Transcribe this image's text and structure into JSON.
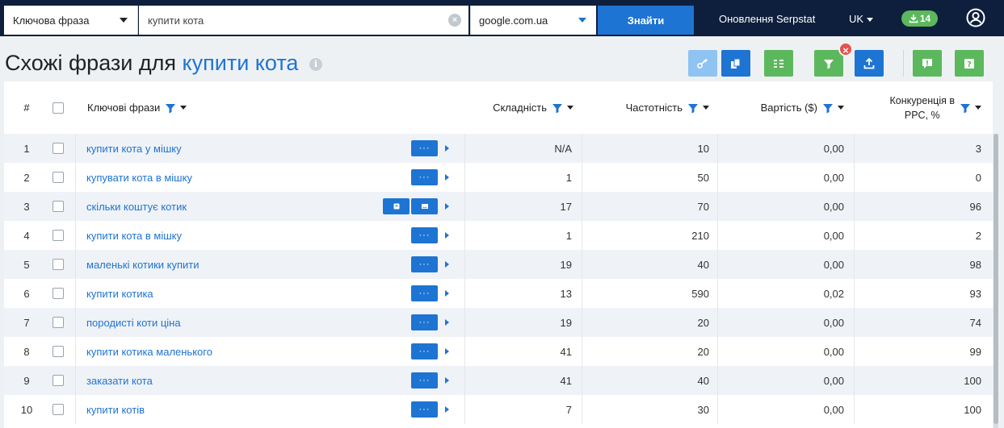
{
  "topbar": {
    "search_type": "Ключова фраза",
    "query": "купити кота",
    "database": "google.com.ua",
    "find_label": "Знайти",
    "updates_label": "Оновлення Serpstat",
    "language": "UK",
    "downloads_count": "14"
  },
  "title": {
    "prefix": "Схожі фрази для",
    "keyword": "купити кота"
  },
  "toolbar": {
    "buttons": [
      "key-icon",
      "copy-icon",
      "columns-icon",
      "filter-icon",
      "export-icon",
      "report-issue-icon",
      "help-icon"
    ],
    "colors": {
      "blue": "#1e74d2",
      "light_blue": "#8fc3f2",
      "green": "#5cb85c",
      "remove": "#e5534b"
    }
  },
  "table": {
    "headers": {
      "num": "#",
      "keyword": "Ключові фрази",
      "difficulty": "Складність",
      "volume": "Частотність",
      "cost": "Вартість ($)",
      "competition_line1": "Конкуренція в",
      "competition_line2": "PPC, %"
    },
    "rows": [
      {
        "num": "1",
        "keyword": "купити кота у мішку",
        "difficulty": "N/A",
        "volume": "10",
        "cost": "0,00",
        "competition": "3"
      },
      {
        "num": "2",
        "keyword": "купувати кота в мішку",
        "difficulty": "1",
        "volume": "50",
        "cost": "0,00",
        "competition": "0"
      },
      {
        "num": "3",
        "keyword": "скільки коштує котик",
        "difficulty": "17",
        "volume": "70",
        "cost": "0,00",
        "competition": "96"
      },
      {
        "num": "4",
        "keyword": "купити кота в мішку",
        "difficulty": "1",
        "volume": "210",
        "cost": "0,00",
        "competition": "2"
      },
      {
        "num": "5",
        "keyword": "маленькі котики купити",
        "difficulty": "19",
        "volume": "40",
        "cost": "0,00",
        "competition": "98"
      },
      {
        "num": "6",
        "keyword": "купити котика",
        "difficulty": "13",
        "volume": "590",
        "cost": "0,02",
        "competition": "93"
      },
      {
        "num": "7",
        "keyword": "породисті коти ціна",
        "difficulty": "19",
        "volume": "20",
        "cost": "0,00",
        "competition": "74"
      },
      {
        "num": "8",
        "keyword": "купити котика маленького",
        "difficulty": "41",
        "volume": "20",
        "cost": "0,00",
        "competition": "99"
      },
      {
        "num": "9",
        "keyword": "заказати кота",
        "difficulty": "41",
        "volume": "40",
        "cost": "0,00",
        "competition": "100"
      },
      {
        "num": "10",
        "keyword": "купити котів",
        "difficulty": "7",
        "volume": "30",
        "cost": "0,00",
        "competition": "100"
      }
    ]
  }
}
